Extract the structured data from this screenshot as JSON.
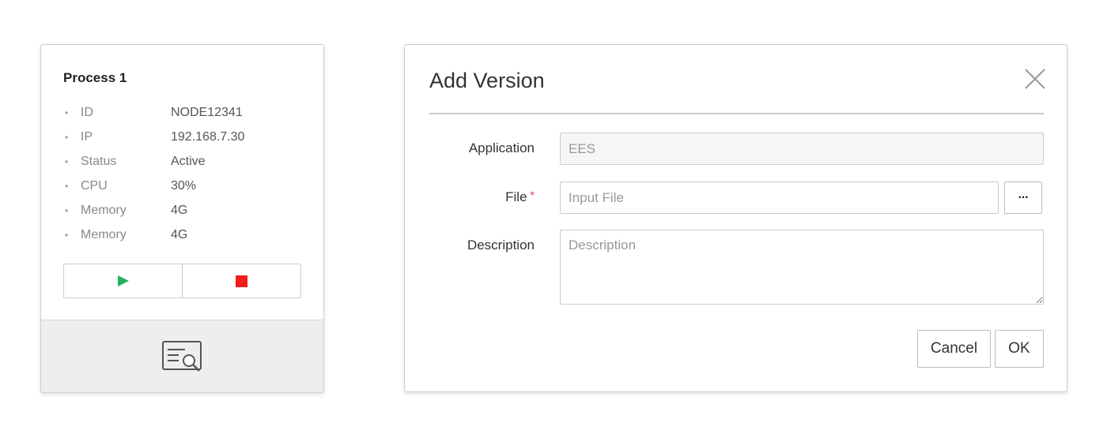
{
  "process_card": {
    "title": "Process 1",
    "properties": [
      {
        "key": "ID",
        "value": "NODE12341"
      },
      {
        "key": "IP",
        "value": "192.168.7.30"
      },
      {
        "key": "Status",
        "value": "Active"
      },
      {
        "key": "CPU",
        "value": "30%"
      },
      {
        "key": "Memory",
        "value": "4G"
      },
      {
        "key": "Memory",
        "value": "4G"
      }
    ],
    "bullet": "•",
    "controls": {
      "start_icon": "play-icon",
      "stop_icon": "stop-icon",
      "start_color": "#21b35a",
      "stop_color": "#f21d1d"
    },
    "footer_icon": "log-search-icon"
  },
  "dialog": {
    "title": "Add Version",
    "close_icon": "close-icon",
    "fields": {
      "application": {
        "label": "Application",
        "value": "EES",
        "disabled": true
      },
      "file": {
        "label": "File",
        "required_mark": "*",
        "placeholder": "Input File",
        "browse_label": "···"
      },
      "description": {
        "label": "Description",
        "placeholder": "Description"
      }
    },
    "buttons": {
      "cancel": "Cancel",
      "ok": "OK"
    }
  }
}
